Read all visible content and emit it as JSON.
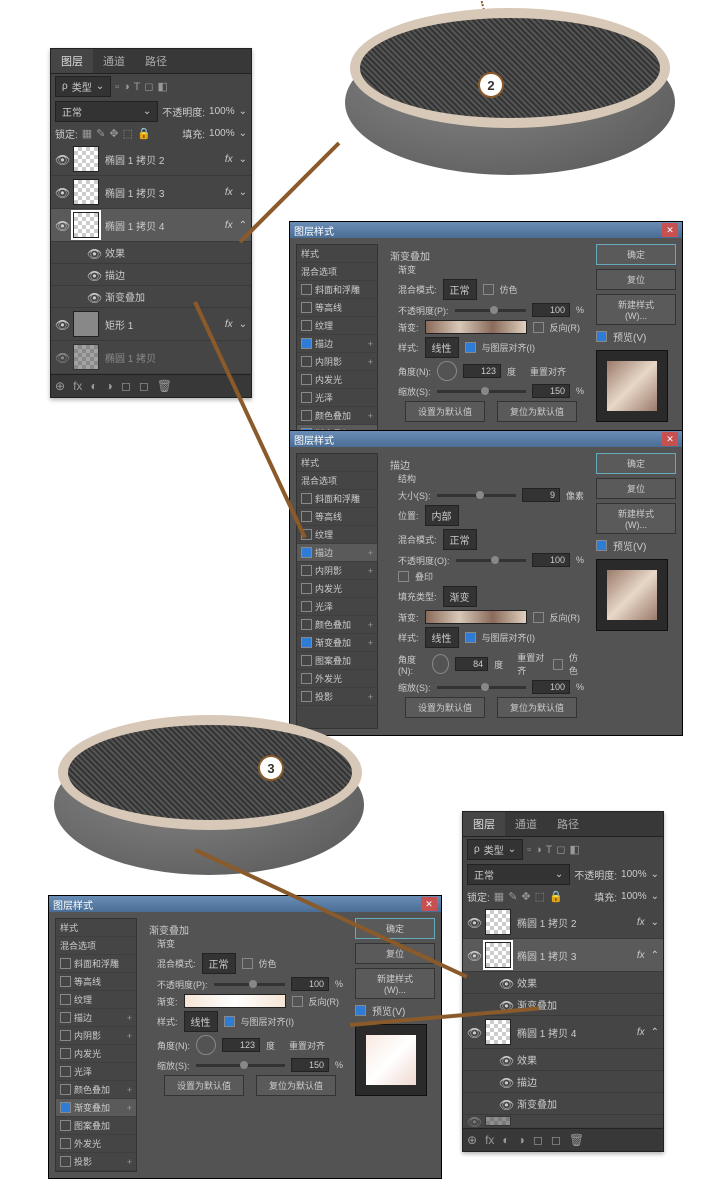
{
  "badges": {
    "step2": "2",
    "step3": "3"
  },
  "layers_panel": {
    "tabs": {
      "layers": "图层",
      "channels": "通道",
      "paths": "路径"
    },
    "type_label": "类型",
    "blend_mode": "正常",
    "opacity_label": "不透明度:",
    "opacity_value": "100%",
    "lock_label": "锁定:",
    "fill_label": "填充:",
    "fill_value": "100%",
    "layers": [
      {
        "name": "椭圆 1 拷贝 2",
        "fx": "fx"
      },
      {
        "name": "椭圆 1 拷贝 3",
        "fx": "fx"
      },
      {
        "name": "椭圆 1 拷贝 4",
        "fx": "fx"
      },
      {
        "name": "效果"
      },
      {
        "name": "描边"
      },
      {
        "name": "渐变叠加"
      },
      {
        "name": "矩形 1",
        "fx": "fx"
      },
      {
        "name": "椭圆 1 拷贝"
      }
    ]
  },
  "layers_panel_b": {
    "layers": [
      {
        "name": "椭圆 1 拷贝 2",
        "fx": "fx"
      },
      {
        "name": "椭圆 1 拷贝 3",
        "fx": "fx"
      },
      {
        "name": "效果"
      },
      {
        "name": "渐变叠加"
      },
      {
        "name": "椭圆 1 拷贝 4",
        "fx": "fx"
      },
      {
        "name": "效果"
      },
      {
        "name": "描边"
      },
      {
        "name": "渐变叠加"
      }
    ]
  },
  "dlg": {
    "title": "图层样式",
    "ok": "确定",
    "cancel": "复位",
    "new_style": "新建样式(W)...",
    "preview": "预览(V)",
    "styles_header": "样式",
    "style_items": {
      "blend_opts": "混合选项",
      "bevel": "斜面和浮雕",
      "contour": "等高线",
      "texture": "纹理",
      "stroke": "描边",
      "inner_shadow": "内阴影",
      "inner_glow": "内发光",
      "satin": "光泽",
      "color_overlay": "颜色叠加",
      "gradient_overlay": "渐变叠加",
      "pattern_overlay": "图案叠加",
      "outer_glow": "外发光",
      "drop_shadow": "投影"
    },
    "grad": {
      "header": "渐变叠加",
      "sub": "渐变",
      "blend": "混合模式:",
      "blend_val": "正常",
      "dither": "仿色",
      "opacity": "不透明度(P):",
      "grad_label": "渐变:",
      "reverse": "反向(R)",
      "style": "样式:",
      "style_val": "线性",
      "align": "与图层对齐(I)",
      "angle": "角度(N):",
      "angle_val": "123",
      "deg": "度",
      "reset_align": "重置对齐",
      "scale": "缩放(S):",
      "scale_val": "150",
      "pct": "%",
      "default": "设置为默认值",
      "reset": "复位为默认值"
    },
    "stroke": {
      "header": "描边",
      "struct": "结构",
      "size": "大小(S):",
      "size_val": "9",
      "px": "像素",
      "pos": "位置:",
      "pos_val": "内部",
      "blend": "混合模式:",
      "blend_val": "正常",
      "opacity": "不透明度(O):",
      "overprint": "叠印",
      "fill_type": "填充类型:",
      "fill_val": "渐变",
      "angle_val": "84"
    }
  }
}
